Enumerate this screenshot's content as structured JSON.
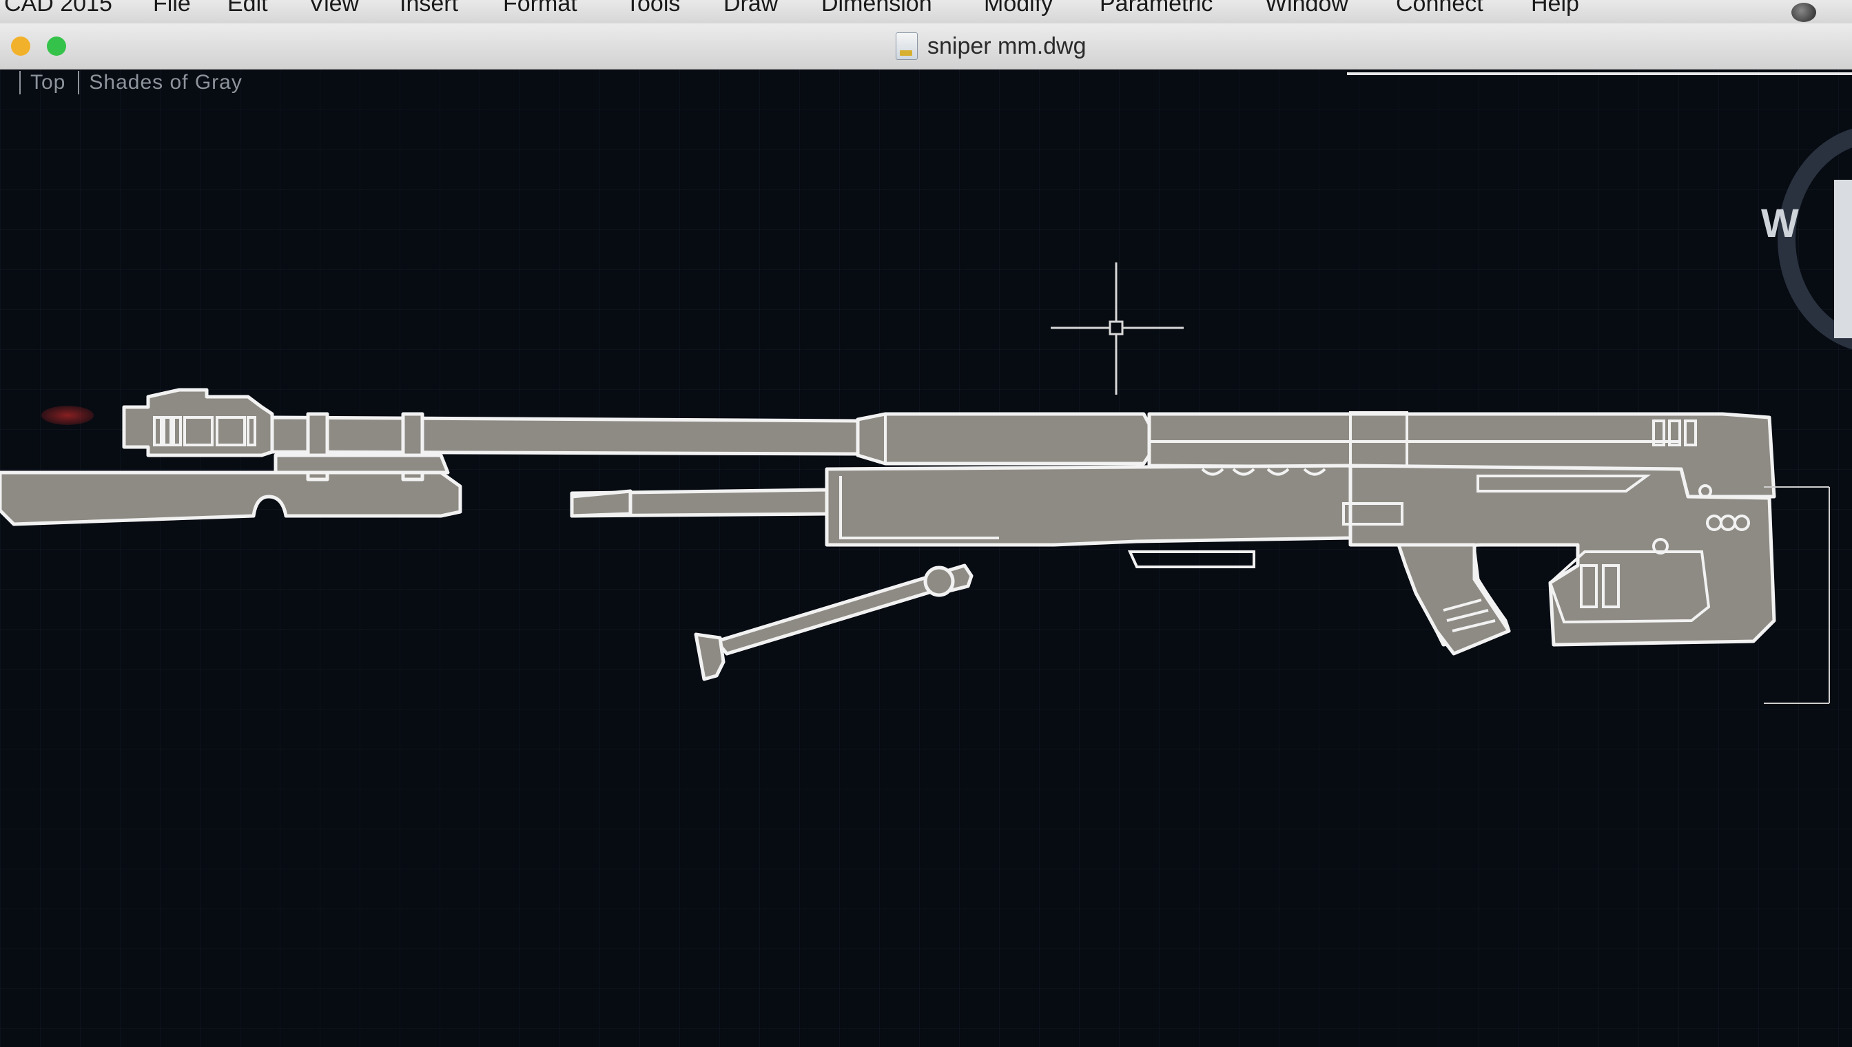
{
  "menubar": {
    "app_name": "CAD 2015",
    "items": [
      "File",
      "Edit",
      "View",
      "Insert",
      "Format",
      "Tools",
      "Draw",
      "Dimension",
      "Modify",
      "Parametric",
      "Window",
      "Connect",
      "Help"
    ]
  },
  "window": {
    "title": "sniper mm.dwg",
    "buttons": [
      "close",
      "minimize",
      "zoom"
    ]
  },
  "viewport": {
    "view_name": "Top",
    "visual_style": "Shades of Gray"
  },
  "viewcube": {
    "label": "W"
  },
  "colors": {
    "canvas_bg": "#070b12",
    "drawing_fill": "#8e8b84",
    "drawing_stroke": "#f2f2f2",
    "crosshair": "#d8d8d8",
    "traffic_yellow": "#f2b12a",
    "traffic_green": "#35c24a"
  }
}
